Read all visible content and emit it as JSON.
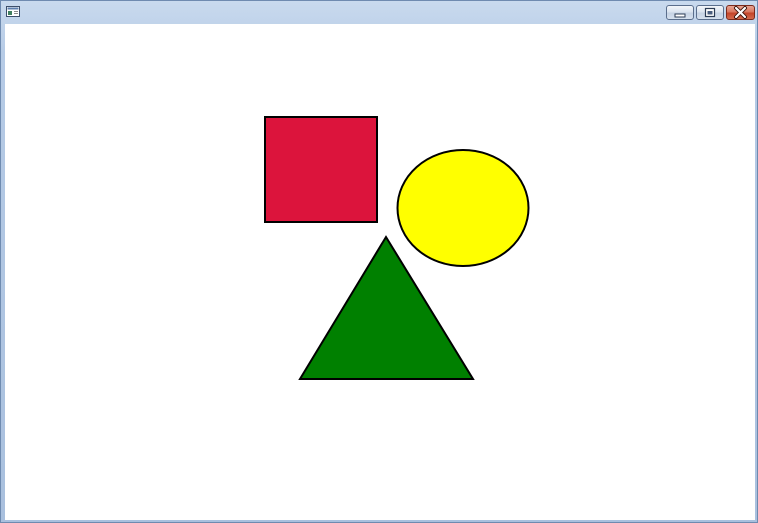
{
  "window": {
    "title": "",
    "controls": {
      "minimize": "minimize-icon",
      "maximize": "maximize-icon",
      "close": "close-icon"
    }
  },
  "canvas": {
    "background": "#ffffff",
    "shapes": [
      {
        "kind": "square",
        "fill": "#dc143c",
        "stroke": "#000000"
      },
      {
        "kind": "circle",
        "fill": "#ffff00",
        "stroke": "#000000"
      },
      {
        "kind": "triangle",
        "fill": "#008000",
        "stroke": "#000000"
      }
    ]
  }
}
